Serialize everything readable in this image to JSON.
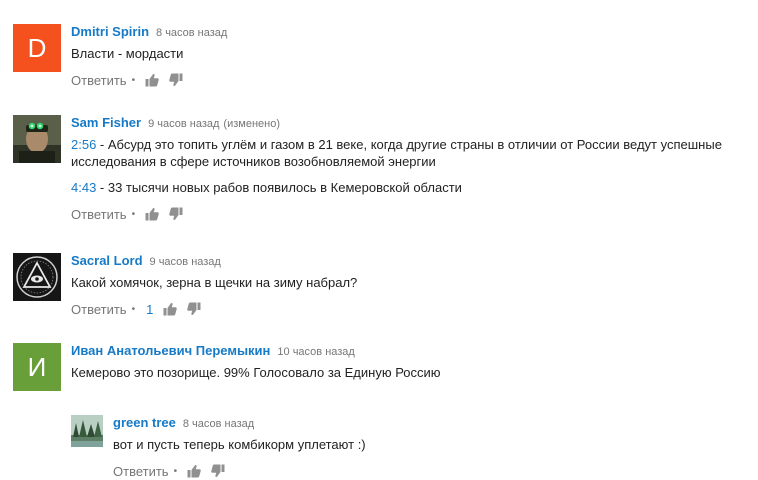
{
  "comments": [
    {
      "author": "Dmitri Spirin",
      "time": "8 часов назад",
      "avatar_letter": "D",
      "avatar_color": "#f4511e",
      "text": "Власти - мордасти",
      "reply_label": "Ответить",
      "dot": "•"
    },
    {
      "author": "Sam Fisher",
      "time": "9 часов назад",
      "edited": "(изменено)",
      "avatar_icon": "soldier-avatar",
      "p1_time": "2:56",
      "p1_text": " - Абсурд это топить углём и газом в 21 веке, когда другие страны в отличии от России ведут успешные исследования в сфере источников возобновляемой энергии",
      "p2_time": "4:43",
      "p2_text": " - 33 тысячи новых рабов появилось в Кемеровской области",
      "reply_label": "Ответить",
      "dot": "•"
    },
    {
      "author": "Sacral Lord",
      "time": "9 часов назад",
      "avatar_icon": "all-seeing-eye-avatar",
      "text": "Какой хомячок, зерна в щечки на зиму набрал?",
      "reply_label": "Ответить",
      "dot": "•",
      "likes": "1"
    },
    {
      "author": "Иван Анатольевич Перемыкин",
      "time": "10 часов назад",
      "avatar_letter": "И",
      "avatar_color": "#689f38",
      "text": "Кемерово это позорище. 99% Голосовало за Единую Россию"
    }
  ],
  "reply": {
    "author": "green tree",
    "time": "8 часов назад",
    "avatar_icon": "forest-avatar",
    "text": "вот и пусть теперь комбикорм уплетают :)",
    "reply_label": "Ответить",
    "dot": "•"
  }
}
